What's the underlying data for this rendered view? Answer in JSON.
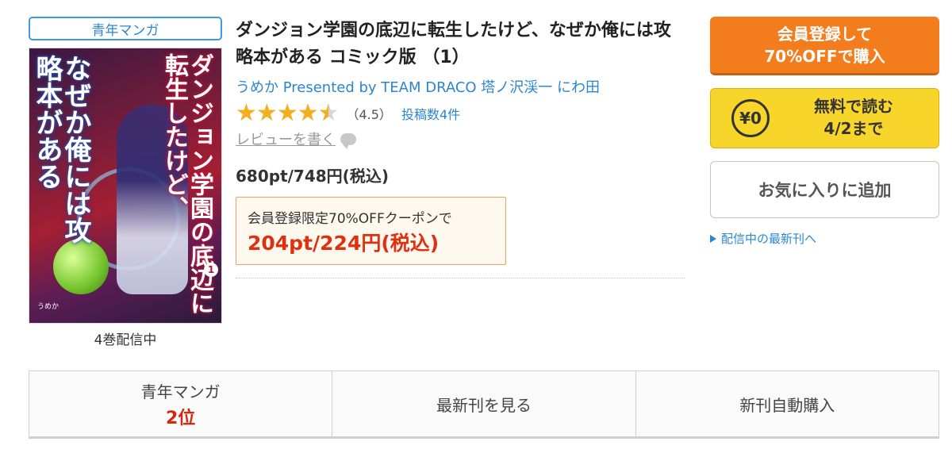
{
  "genre_tag": "青年マンガ",
  "cover": {
    "title_vertical": "ダンジョン学園の底辺に転生したけど、",
    "subtitle_vertical": "なぜか俺には攻略本がある",
    "volume": "1",
    "author_credit": "うめか"
  },
  "volume_status": "4巻配信中",
  "title": "ダンジョン学園の底辺に転生したけど、なぜか俺には攻略本がある コミック版 （1）",
  "authors": "うめか Presented by TEAM DRACO 塔ノ沢渓一 にわ田",
  "rating": {
    "value": 4.5,
    "stars_max": 5,
    "display": "（4.5）",
    "review_count": "投稿数4件"
  },
  "write_review": "レビューを書く",
  "price": "680pt/748円(税込)",
  "coupon": {
    "label": "会員登録限定70%OFFクーポンで",
    "price": "204pt/224円(税込)"
  },
  "buttons": {
    "register_line1": "会員登録して",
    "register_line2": "70%OFFで購入",
    "free_yen": "¥0",
    "free_line1": "無料で読む",
    "free_line2": "4/2まで",
    "favorite": "お気に入りに追加"
  },
  "latest_link": "配信中の最新刊へ",
  "tabs": {
    "ranking_genre": "青年マンガ",
    "ranking_rank": "2位",
    "latest": "最新刊を見る",
    "auto_buy": "新刊自動購入"
  },
  "colors": {
    "register_button": "#f37d1c",
    "free_button": "#f8d52a",
    "link": "#2a86d1",
    "coupon_price": "#e03010",
    "star": "#f2b01e"
  }
}
